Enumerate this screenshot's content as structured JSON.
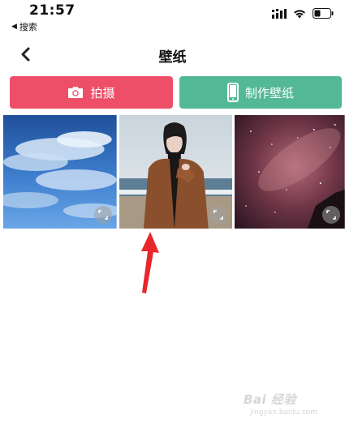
{
  "status_bar": {
    "time": "21:57",
    "back_app": "搜索"
  },
  "nav": {
    "title": "壁纸"
  },
  "actions": {
    "shoot_label": "拍摄",
    "make_label": "制作壁纸"
  },
  "wallpapers": [
    {
      "subject": "sky with clouds and moon"
    },
    {
      "subject": "woman in brown coat on beach"
    },
    {
      "subject": "starry night sky"
    }
  ],
  "watermark": {
    "brand": "Bai 经验",
    "url": "jingyan.baidu.com"
  },
  "colors": {
    "shoot_button": "#ee4f68",
    "make_button": "#53b896",
    "annotation_arrow": "#e8262c"
  },
  "icons": [
    "signal-icon",
    "wifi-icon",
    "battery-icon",
    "back-chevron-icon",
    "camera-icon",
    "phone-icon",
    "expand-icon"
  ]
}
